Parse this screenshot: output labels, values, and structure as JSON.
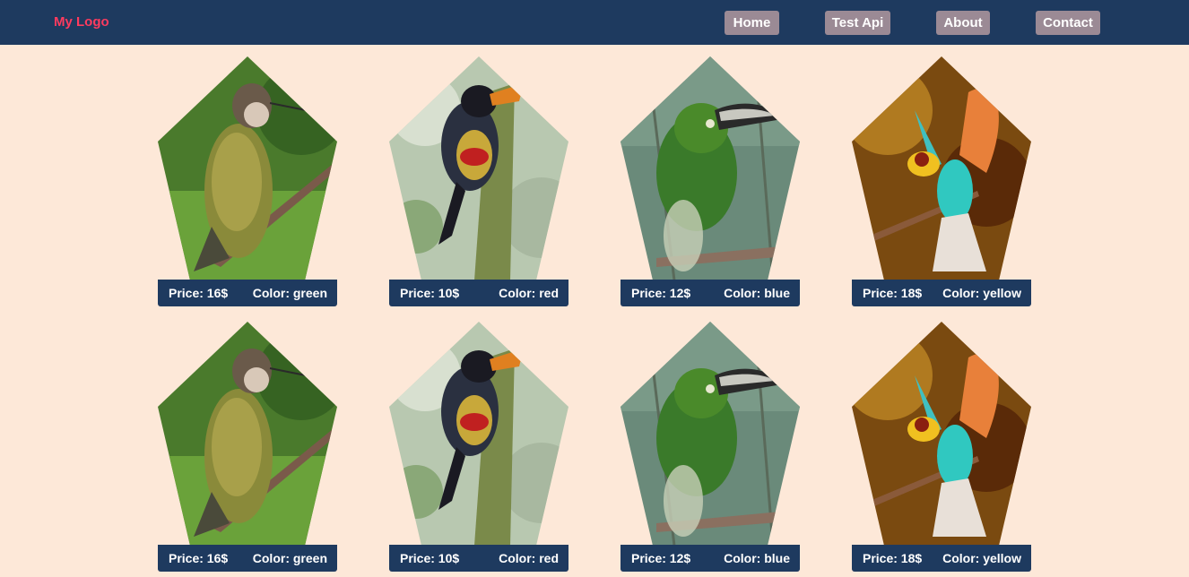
{
  "navbar": {
    "logo": "My Logo",
    "links": [
      {
        "label": "Home"
      },
      {
        "label": "Test Api"
      },
      {
        "label": "About"
      },
      {
        "label": "Contact"
      }
    ]
  },
  "products": [
    {
      "price": "Price: 16$",
      "color": "Color: green",
      "bird": "hummingbird"
    },
    {
      "price": "Price: 10$",
      "color": "Color: red",
      "bird": "aracari"
    },
    {
      "price": "Price: 12$",
      "color": "Color: blue",
      "bird": "toucanet"
    },
    {
      "price": "Price: 18$",
      "color": "Color: yellow",
      "bird": "bee-eater"
    },
    {
      "price": "Price: 16$",
      "color": "Color: green",
      "bird": "hummingbird"
    },
    {
      "price": "Price: 10$",
      "color": "Color: red",
      "bird": "aracari"
    },
    {
      "price": "Price: 12$",
      "color": "Color: blue",
      "bird": "toucanet"
    },
    {
      "price": "Price: 18$",
      "color": "Color: yellow",
      "bird": "bee-eater"
    }
  ],
  "colors": {
    "navbar_bg": "#1e3a5f",
    "page_bg": "#fde8d8",
    "logo": "#ff3b5f",
    "nav_button": "#9b8a95"
  }
}
